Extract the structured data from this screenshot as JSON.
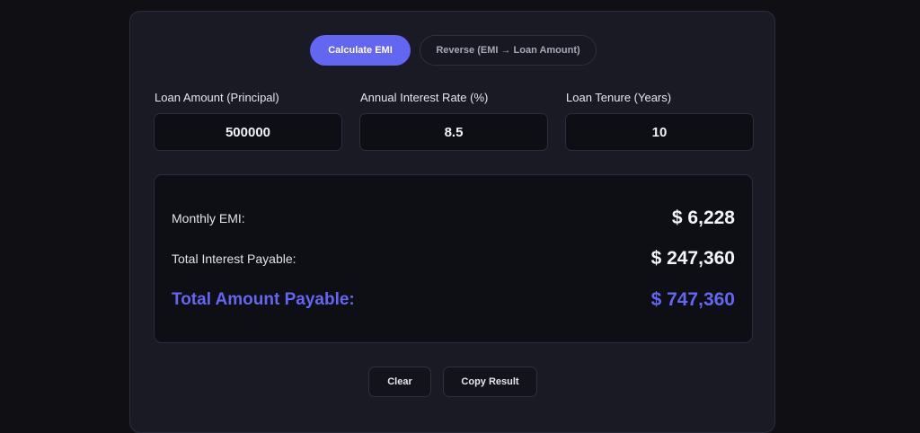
{
  "mode_toggle": {
    "calculate_label": "Calculate EMI",
    "reverse_label": "Reverse (EMI → Loan Amount)"
  },
  "inputs": {
    "principal": {
      "label": "Loan Amount (Principal)",
      "value": "500000"
    },
    "rate": {
      "label": "Annual Interest Rate (%)",
      "value": "8.5"
    },
    "tenure": {
      "label": "Loan Tenure (Years)",
      "value": "10"
    }
  },
  "results": {
    "monthly_emi": {
      "label": "Monthly EMI:",
      "value": "$ 6,228"
    },
    "total_interest": {
      "label": "Total Interest Payable:",
      "value": "$ 247,360"
    },
    "total_amount": {
      "label": "Total Amount Payable:",
      "value": "$ 747,360"
    }
  },
  "actions": {
    "clear_label": "Clear",
    "copy_label": "Copy Result"
  },
  "colors": {
    "accent": "#6366f1",
    "page_bg": "#101014",
    "card_bg": "#191a24",
    "input_bg": "#0e0e15"
  }
}
